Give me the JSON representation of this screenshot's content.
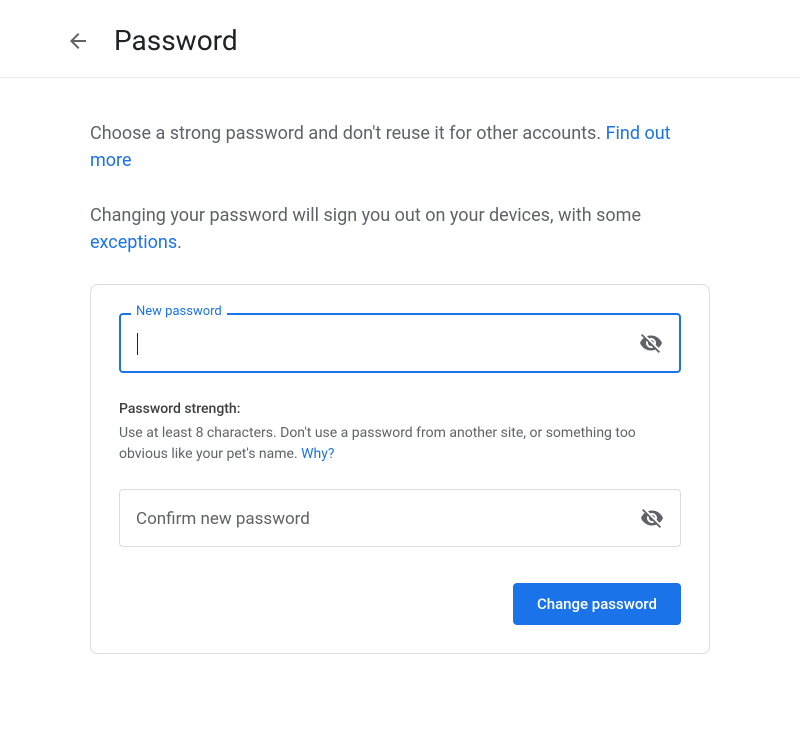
{
  "header": {
    "title": "Password"
  },
  "intro": {
    "line1_text": "Choose a strong password and don't reuse it for other accounts. ",
    "line1_link": "Find out more",
    "line2_text": "Changing your password will sign you out on your devices, with some ",
    "line2_link": "exceptions",
    "line2_suffix": "."
  },
  "form": {
    "new_password_label": "New password",
    "confirm_placeholder": "Confirm new password",
    "strength_title": "Password strength:",
    "strength_text": "Use at least 8 characters. Don't use a password from another site, or something too obvious like your pet's name. ",
    "strength_link": "Why?",
    "submit_label": "Change password"
  }
}
